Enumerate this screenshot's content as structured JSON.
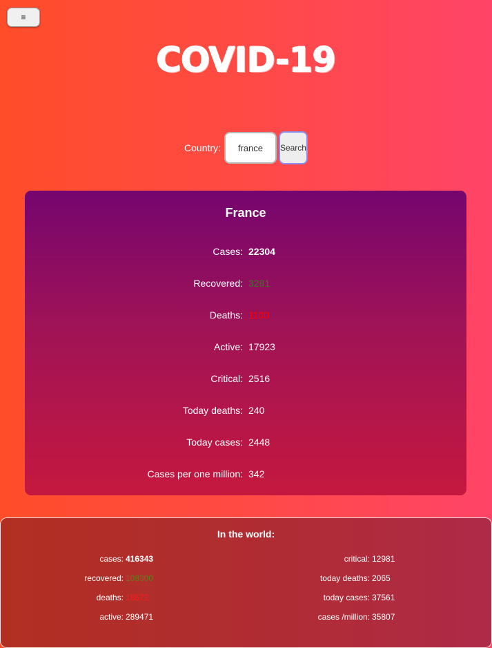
{
  "menu": {
    "icon": "hamburger-icon",
    "glyph": "≡"
  },
  "header": {
    "title": "COVID-19"
  },
  "search": {
    "label": "Country:",
    "value": "france",
    "button_label": "Search"
  },
  "country": {
    "name": "France",
    "stats": [
      {
        "label": "Cases:",
        "value": "22304",
        "color": "#ffffff",
        "bold": true
      },
      {
        "label": "Recovered:",
        "value": "3281",
        "color": "#2e7d1f",
        "bold": false
      },
      {
        "label": "Deaths:",
        "value": "1100",
        "color": "#ff0000",
        "bold": false
      },
      {
        "label": "Active:",
        "value": "17923",
        "color": "#ffffff",
        "bold": false
      },
      {
        "label": "Critical:",
        "value": "2516",
        "color": "#ffffff",
        "bold": false
      },
      {
        "label": "Today deaths:",
        "value": "240",
        "color": "#ffffff",
        "bold": false
      },
      {
        "label": "Today cases:",
        "value": "2448",
        "color": "#ffffff",
        "bold": false
      },
      {
        "label": "Cases per one million:",
        "value": "342",
        "color": "#ffffff",
        "bold": false
      }
    ]
  },
  "world": {
    "title": "In the world:",
    "left": [
      {
        "label": "cases:",
        "value": "416343",
        "color": "#ffffff",
        "bold": true
      },
      {
        "label": "recovered:",
        "value": "108300",
        "color": "#5f7d1a",
        "bold": false
      },
      {
        "label": "deaths:",
        "value": "18572",
        "color": "#ff1a1a",
        "bold": false
      },
      {
        "label": "active:",
        "value": "289471",
        "color": "#ffffff",
        "bold": false
      }
    ],
    "right": [
      {
        "label": "critical:",
        "value": "12981",
        "color": "#ffffff",
        "bold": false
      },
      {
        "label": "today deaths:",
        "value": "2065",
        "color": "#ffffff",
        "bold": false
      },
      {
        "label": "today cases:",
        "value": "37561",
        "color": "#ffffff",
        "bold": false
      },
      {
        "label": "cases /million:",
        "value": "35807",
        "color": "#ffffff",
        "bold": false
      }
    ]
  }
}
